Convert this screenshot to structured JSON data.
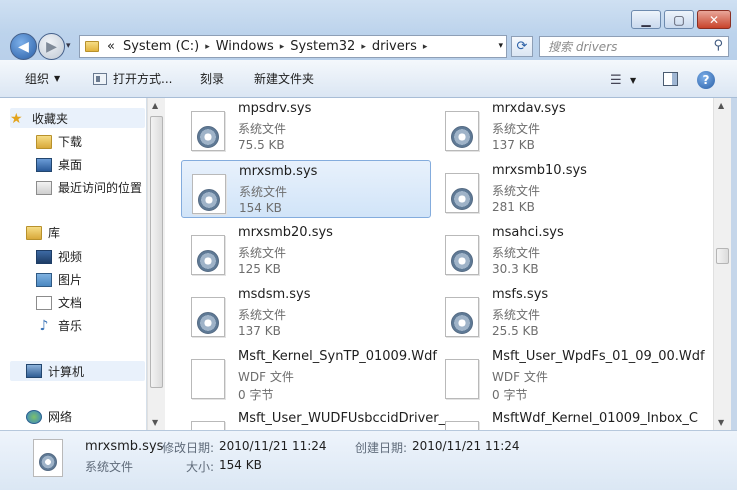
{
  "window": {
    "min_icon": "minimize-icon",
    "max_icon": "maximize-icon",
    "close_icon": "close-icon"
  },
  "nav": {
    "back_icon": "back-arrow-icon",
    "forward_icon": "forward-arrow-icon",
    "address": {
      "prefix": "«",
      "segments": [
        "System (C:)",
        "Windows",
        "System32",
        "drivers"
      ],
      "separator": "▸",
      "dropdown": "▾"
    },
    "refresh_icon": "refresh-icon",
    "search_placeholder": "搜索 drivers"
  },
  "toolbar": {
    "organize": "组织",
    "open_with": "打开方式...",
    "burn": "刻录",
    "new_folder": "新建文件夹"
  },
  "sidebar": {
    "favorites": "收藏夹",
    "fav_items": [
      "下载",
      "桌面",
      "最近访问的位置"
    ],
    "libraries": "库",
    "lib_items": [
      "视频",
      "图片",
      "文档",
      "音乐"
    ],
    "computer": "计算机",
    "network": "网络"
  },
  "files": [
    {
      "name": "mpsdrv.sys",
      "type": "系统文件",
      "size": "75.5 KB",
      "icon": "system-file-icon"
    },
    {
      "name": "mrxdav.sys",
      "type": "系统文件",
      "size": "137 KB",
      "icon": "system-file-icon"
    },
    {
      "name": "mrxsmb.sys",
      "type": "系统文件",
      "size": "154 KB",
      "icon": "system-file-icon",
      "selected": true
    },
    {
      "name": "mrxsmb10.sys",
      "type": "系统文件",
      "size": "281 KB",
      "icon": "system-file-icon"
    },
    {
      "name": "mrxsmb20.sys",
      "type": "系统文件",
      "size": "125 KB",
      "icon": "system-file-icon"
    },
    {
      "name": "msahci.sys",
      "type": "系统文件",
      "size": "30.3 KB",
      "icon": "system-file-icon"
    },
    {
      "name": "msdsm.sys",
      "type": "系统文件",
      "size": "137 KB",
      "icon": "system-file-icon"
    },
    {
      "name": "msfs.sys",
      "type": "系统文件",
      "size": "25.5 KB",
      "icon": "system-file-icon"
    },
    {
      "name": "Msft_Kernel_SynTP_01009.Wdf",
      "type": "WDF 文件",
      "size": "0 字节",
      "icon": "blank-file-icon"
    },
    {
      "name": "Msft_User_WpdFs_01_09_00.Wdf",
      "type": "WDF 文件",
      "size": "0 字节",
      "icon": "blank-file-icon"
    },
    {
      "name": "Msft_User_WUDFUsbccidDriver_",
      "type": "",
      "size": "",
      "icon": "blank-file-icon"
    },
    {
      "name": "MsftWdf_Kernel_01009_Inbox_C",
      "type": "",
      "size": "",
      "icon": "blank-file-icon"
    }
  ],
  "details": {
    "name": "mrxsmb.sys",
    "type": "系统文件",
    "modified_label": "修改日期:",
    "modified": "2010/11/21 11:24",
    "created_label": "创建日期:",
    "created": "2010/11/21 11:24",
    "size_label": "大小:",
    "size": "154 KB"
  }
}
